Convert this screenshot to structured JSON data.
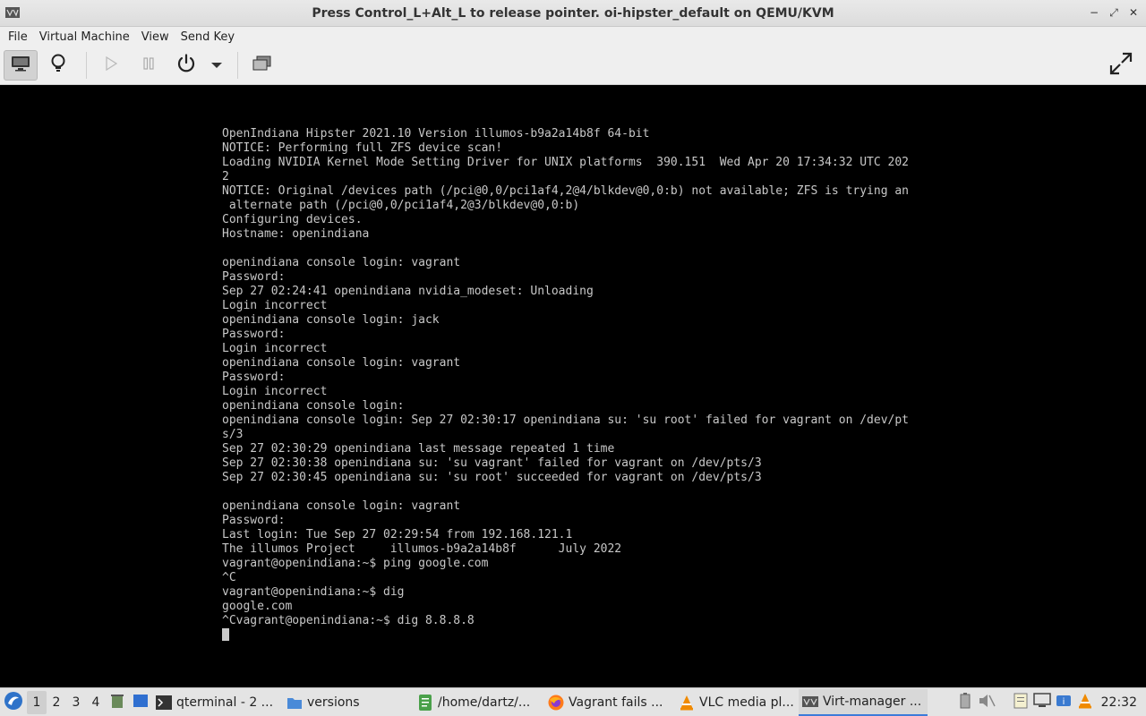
{
  "window": {
    "title": "Press Control_L+Alt_L to release pointer. oi-hipster_default on QEMU/KVM",
    "controls": {
      "minimize": "−",
      "restore": "⤢",
      "close": "✕"
    }
  },
  "menubar": {
    "items": [
      "File",
      "Virtual Machine",
      "View",
      "Send Key"
    ]
  },
  "toolbar": {
    "buttons": [
      "console-view",
      "details-view",
      "run",
      "pause",
      "shutdown",
      "shutdown-menu",
      "snapshots",
      "fullscreen"
    ]
  },
  "console": {
    "lines": [
      "OpenIndiana Hipster 2021.10 Version illumos-b9a2a14b8f 64-bit",
      "NOTICE: Performing full ZFS device scan!",
      "Loading NVIDIA Kernel Mode Setting Driver for UNIX platforms  390.151  Wed Apr 20 17:34:32 UTC 202",
      "2",
      "NOTICE: Original /devices path (/pci@0,0/pci1af4,2@4/blkdev@0,0:b) not available; ZFS is trying an",
      " alternate path (/pci@0,0/pci1af4,2@3/blkdev@0,0:b)",
      "Configuring devices.",
      "Hostname: openindiana",
      "",
      "openindiana console login: vagrant",
      "Password:",
      "Sep 27 02:24:41 openindiana nvidia_modeset: Unloading",
      "Login incorrect",
      "openindiana console login: jack",
      "Password:",
      "Login incorrect",
      "openindiana console login: vagrant",
      "Password:",
      "Login incorrect",
      "openindiana console login:",
      "openindiana console login: Sep 27 02:30:17 openindiana su: 'su root' failed for vagrant on /dev/pt",
      "s/3",
      "Sep 27 02:30:29 openindiana last message repeated 1 time",
      "Sep 27 02:30:38 openindiana su: 'su vagrant' failed for vagrant on /dev/pts/3",
      "Sep 27 02:30:45 openindiana su: 'su root' succeeded for vagrant on /dev/pts/3",
      "",
      "openindiana console login: vagrant",
      "Password:",
      "Last login: Tue Sep 27 02:29:54 from 192.168.121.1",
      "The illumos Project     illumos-b9a2a14b8f      July 2022",
      "vagrant@openindiana:~$ ping google.com",
      "^C",
      "vagrant@openindiana:~$ dig",
      "google.com",
      "^Cvagrant@openindiana:~$ dig 8.8.8.8"
    ]
  },
  "taskbar": {
    "workspaces": [
      "1",
      "2",
      "3",
      "4"
    ],
    "active_workspace": "1",
    "tasks": [
      {
        "label": "qterminal - 2 ...",
        "icon": "terminal-icon"
      },
      {
        "label": "versions",
        "icon": "folder-icon"
      },
      {
        "label": "/home/dartz/...",
        "icon": "text-editor-icon"
      },
      {
        "label": "Vagrant fails ...",
        "icon": "firefox-icon"
      },
      {
        "label": "VLC media pl...",
        "icon": "vlc-icon"
      },
      {
        "label": "Virt-manager ...",
        "icon": "virt-manager-icon"
      }
    ],
    "clock": "22:32"
  },
  "colors": {
    "console_bg": "#000000",
    "console_fg": "#c8c8c8",
    "chrome_bg": "#efefef",
    "taskbar_bg": "#e4e4e4",
    "accent": "#3d7bd9"
  }
}
